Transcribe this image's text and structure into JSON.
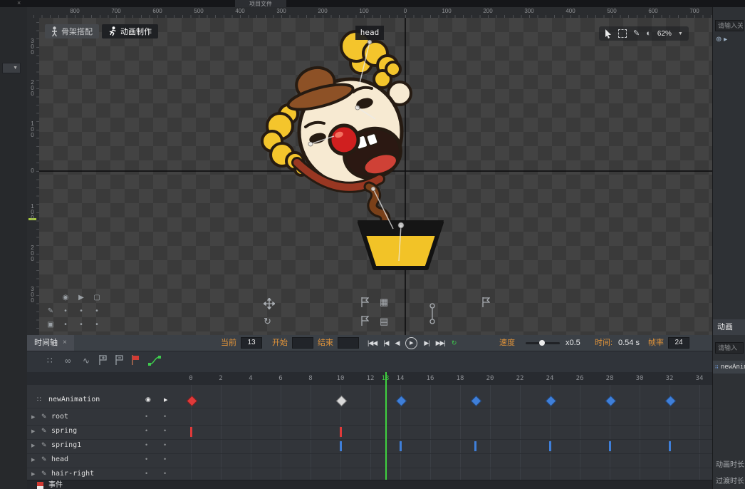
{
  "top_bar": {
    "project_tab": "项目文件",
    "close": "×"
  },
  "mode_tabs": {
    "rig": "骨架搭配",
    "animate": "动画制作"
  },
  "canvas": {
    "selected_bone_label": "head",
    "zoom": "62%",
    "h_ruler": [
      "800",
      "700",
      "600",
      "500",
      "400",
      "300",
      "200",
      "100",
      "0",
      "100",
      "200",
      "300",
      "400",
      "500",
      "600",
      "700"
    ],
    "v_ruler": [
      "300",
      "200",
      "100",
      "0",
      "100",
      "200",
      "300"
    ]
  },
  "canvas_toggles": {
    "row1": [
      "◉",
      "▶",
      "▢"
    ],
    "row2": [
      "✎",
      "•",
      "•",
      "•"
    ],
    "row3": [
      "▣",
      "•",
      "•",
      "•"
    ]
  },
  "right_panel": {
    "search_top": "请输入关",
    "anim_tab_label": "动画",
    "search_bottom": "请输入",
    "animation_item": "newAnimation",
    "duration_label": "动画时长",
    "transition_label": "过渡时长"
  },
  "timeline": {
    "tab_label": "时间轴",
    "tab_close": "×",
    "current_label": "当前",
    "current_value": "13",
    "start_label": "开始",
    "start_value": "",
    "end_label": "结束",
    "end_value": "",
    "speed_label": "速度",
    "speed_value": "x0.5",
    "time_label": "时间:",
    "time_value": "0.54 s",
    "fps_label": "帧率",
    "fps_value": "24",
    "frame_ticks": [
      0,
      2,
      4,
      6,
      8,
      10,
      12,
      14,
      16,
      18,
      20,
      22,
      24,
      26,
      28,
      30,
      32,
      34
    ],
    "playhead_frame": 13,
    "transport": [
      {
        "name": "jump-start-button",
        "glyph": "|◀◀"
      },
      {
        "name": "prev-key-button",
        "glyph": "|◀"
      },
      {
        "name": "prev-frame-button",
        "glyph": "◀"
      },
      {
        "name": "play-button",
        "glyph": "▶",
        "circled": true
      },
      {
        "name": "next-frame-button",
        "glyph": "▶|"
      },
      {
        "name": "next-key-button",
        "glyph": "▶▶|"
      },
      {
        "name": "loop-button",
        "glyph": "↻",
        "color": "#3ecb4e"
      }
    ],
    "tracks": [
      {
        "name": "newAnimation",
        "kind": "animation",
        "keyframes": [
          {
            "frame": 0,
            "color": "#e03a3a"
          },
          {
            "frame": 10,
            "color": "#d9d9d9"
          },
          {
            "frame": 14,
            "color": "#3f7fd9"
          },
          {
            "frame": 19,
            "color": "#3f7fd9"
          },
          {
            "frame": 24,
            "color": "#3f7fd9"
          },
          {
            "frame": 28,
            "color": "#3f7fd9"
          },
          {
            "frame": 32,
            "color": "#3f7fd9"
          }
        ],
        "bars": []
      },
      {
        "name": "root",
        "kind": "bone",
        "keyframes": [],
        "bars": []
      },
      {
        "name": "spring",
        "kind": "bone",
        "keyframes": [],
        "bars": [
          {
            "frame": 0,
            "color": "#e03a3a"
          },
          {
            "frame": 10,
            "color": "#e03a3a"
          }
        ]
      },
      {
        "name": "spring1",
        "kind": "bone",
        "keyframes": [],
        "bars": [
          {
            "frame": 10,
            "color": "#3f7fd9"
          },
          {
            "frame": 14,
            "color": "#3f7fd9"
          },
          {
            "frame": 19,
            "color": "#3f7fd9"
          },
          {
            "frame": 24,
            "color": "#3f7fd9"
          },
          {
            "frame": 28,
            "color": "#3f7fd9"
          },
          {
            "frame": 32,
            "color": "#3f7fd9"
          }
        ]
      },
      {
        "name": "head",
        "kind": "bone",
        "keyframes": [],
        "bars": []
      },
      {
        "name": "hair-right",
        "kind": "bone",
        "keyframes": [],
        "bars": []
      }
    ],
    "events_label": "事件"
  },
  "icons": {
    "dropdown_arrow": "▼",
    "rotate": "↻",
    "image_front": "▦",
    "image_back": "▤",
    "pencil": "✎",
    "plus_circle": "⊕",
    "caret_right": "▸",
    "dots_grid": "∷",
    "link_infinity": "∞",
    "wave_curve": "∿",
    "sphere": "◐",
    "record": "◉",
    "play_small": "▶"
  },
  "colors": {
    "playhead_green": "#3fd13f",
    "keyframe_blue": "#3f7fd9",
    "keyframe_red": "#e03a3a",
    "keyframe_white": "#d9d9d9",
    "label_orange": "#e2943a"
  }
}
